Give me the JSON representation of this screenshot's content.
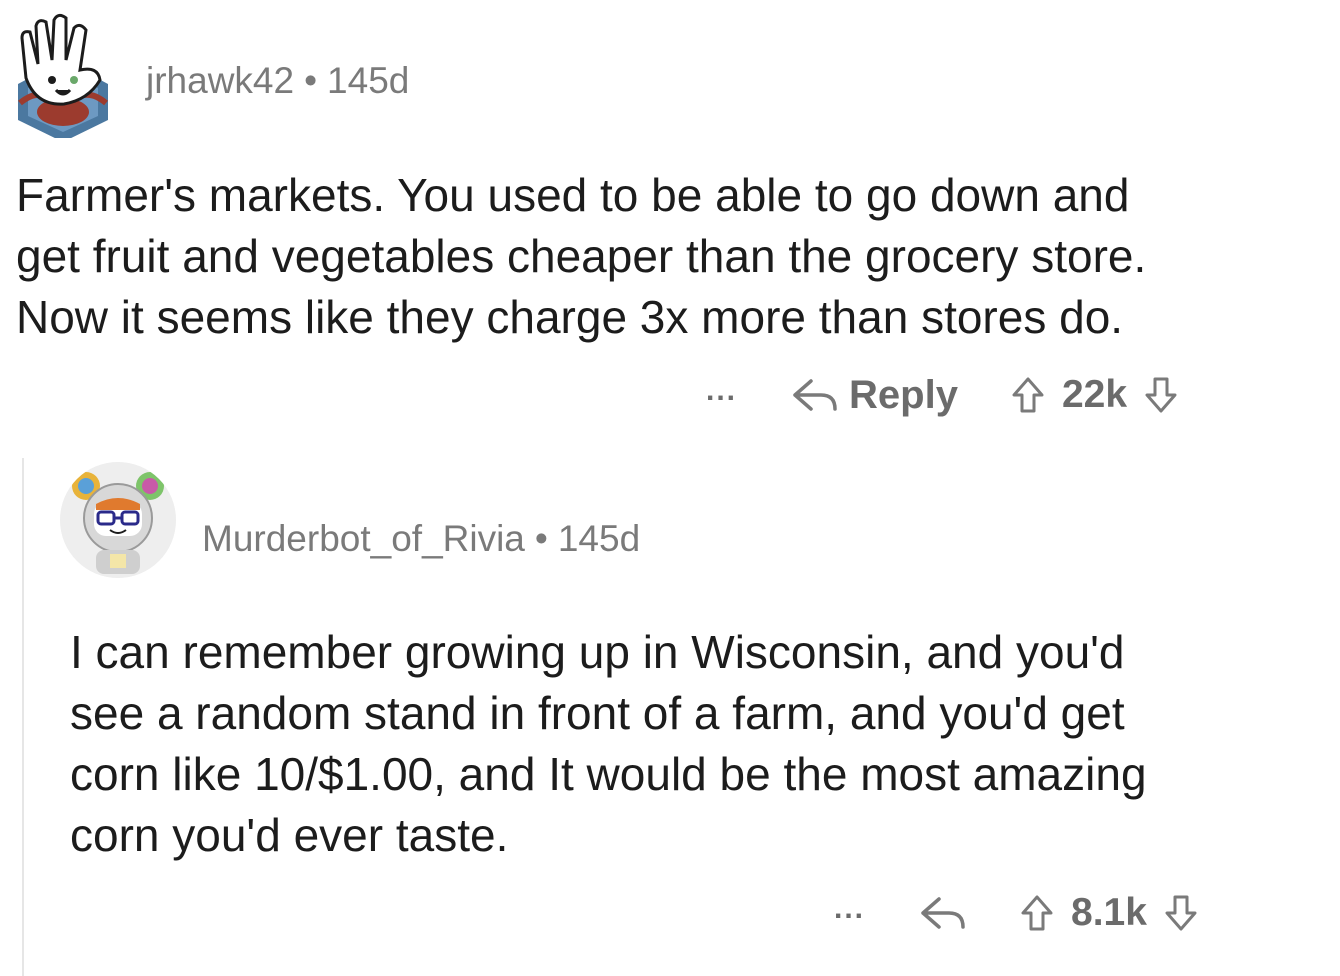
{
  "comments": [
    {
      "username": "jrhawk42",
      "age": "145d",
      "body": "Farmer's markets. You used to be able to go down and\nget fruit and vegetables cheaper than the grocery store.\nNow it seems like they charge 3x more than stores do.",
      "more_label": "...",
      "reply_label": "Reply",
      "score": "22k",
      "avatar": "hand-avatar-icon"
    },
    {
      "username": "Murderbot_of_Rivia",
      "age": "145d",
      "body": "I can remember growing up in Wisconsin, and you'd\nsee a random stand in front of a farm, and you'd get\ncorn like 10/$1.00, and It would be the most amazing\ncorn you'd ever taste.",
      "more_label": "...",
      "score": "8.1k",
      "avatar": "astronaut-avatar-icon"
    }
  ],
  "separator": "•",
  "colors": {
    "meta_text": "#7a7a7a",
    "body_text": "#1c1c1c",
    "action_text": "#6b6b6b",
    "thread_line": "#e6e6e6"
  }
}
